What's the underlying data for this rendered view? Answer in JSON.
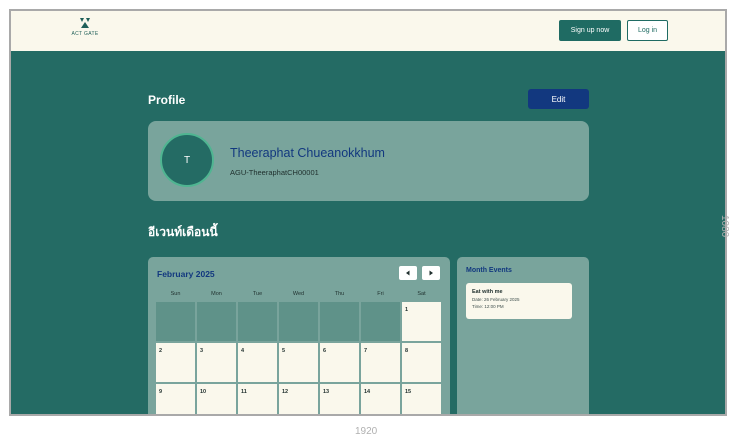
{
  "header": {
    "logo_text": "ACT GATE",
    "signup_label": "Sign up now",
    "login_label": "Log in"
  },
  "profile": {
    "title": "Profile",
    "edit_label": "Edit",
    "avatar_initial": "T",
    "name": "Theeraphat Chueanokkhum",
    "user_id": "AGU-TheeraphatCH00001"
  },
  "section_title": "อีเวนท์เดือนนี้",
  "calendar": {
    "month": "February 2025",
    "weekdays": [
      "Sun",
      "Mon",
      "Tue",
      "Wed",
      "Thu",
      "Fri",
      "Sat"
    ],
    "leading_empty": 6,
    "days": [
      "1",
      "2",
      "3",
      "4",
      "5",
      "6",
      "7",
      "8",
      "9",
      "10",
      "11",
      "12",
      "13",
      "14",
      "15"
    ]
  },
  "month_events": {
    "title": "Month Events",
    "items": [
      {
        "title": "Eat with me",
        "date": "Date: 26 February 2025",
        "time": "Time: 12:00 PM"
      }
    ]
  },
  "dimensions": {
    "width_label": "1920",
    "height_label": "1080"
  },
  "colors": {
    "page_bg": "#246b64",
    "card_bg": "#79a49c",
    "accent_blue": "#12387f",
    "cream": "#faf8ec"
  }
}
